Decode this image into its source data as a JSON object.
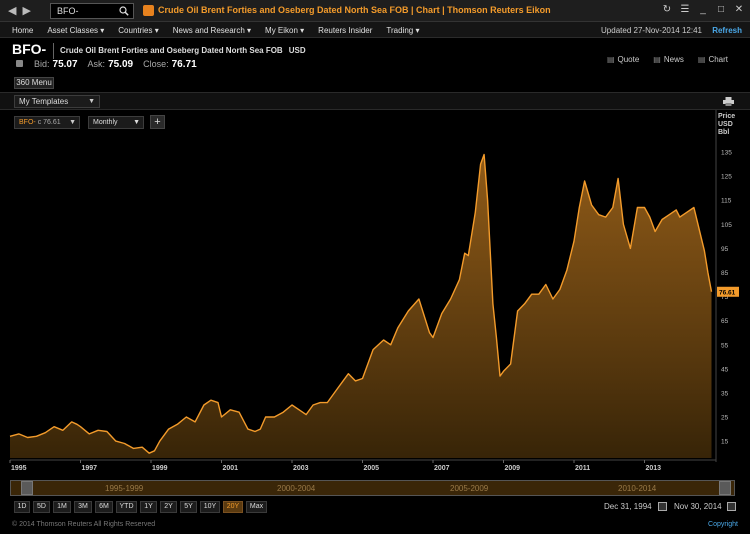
{
  "titlebar": {
    "search_value": "BFO-",
    "window_title": "Crude Oil Brent Forties and Oseberg Dated North Sea FOB | Chart | Thomson Reuters Eikon"
  },
  "menubar": {
    "items": [
      "Home",
      "Asset Classes ▾",
      "Countries ▾",
      "News and Research ▾",
      "My Eikon ▾",
      "Reuters Insider",
      "Trading ▾"
    ],
    "updated": "Updated 27-Nov-2014 12:41",
    "refresh": "Refresh"
  },
  "header": {
    "ric": "BFO-",
    "instrument_name": "Crude Oil Brent Forties and Oseberg Dated North Sea FOB",
    "currency": "USD",
    "bid_label": "Bid:",
    "bid": "75.07",
    "ask_label": "Ask:",
    "ask": "75.09",
    "close_label": "Close:",
    "close": "76.71",
    "links": [
      "Quote",
      "News",
      "Chart"
    ],
    "menu360": "360 Menu"
  },
  "templates": {
    "label": "My Templates"
  },
  "chart_toolbar": {
    "series_ric": "BFO-",
    "series_value": "c 76.61",
    "interval": "Monthly",
    "add": "+"
  },
  "chart_data": {
    "type": "area",
    "title": "",
    "ylabel": "Price USD Bbl",
    "ylim": [
      8,
      140
    ],
    "yticks": [
      15,
      25,
      35,
      45,
      55,
      65,
      75,
      85,
      95,
      105,
      115,
      125,
      135
    ],
    "xticks": [
      "1995",
      "1997",
      "1999",
      "2001",
      "2003",
      "2005",
      "2007",
      "2009",
      "2011",
      "2013"
    ],
    "xlim": [
      1995.0,
      2015.0
    ],
    "last_value_label": "76.61",
    "color": "#f39b2b",
    "grid": false,
    "series": [
      {
        "x": [
          1995.0,
          1995.25,
          1995.5,
          1995.75,
          1996.0,
          1996.25,
          1996.5,
          1996.75,
          1996.9,
          1997.0,
          1997.25,
          1997.5,
          1997.75,
          1998.0,
          1998.25,
          1998.5,
          1998.75,
          1998.95,
          1999.1,
          1999.25,
          1999.5,
          1999.75,
          2000.0,
          2000.25,
          2000.5,
          2000.7,
          2000.9,
          2001.0,
          2001.25,
          2001.5,
          2001.75,
          2001.95,
          2002.1,
          2002.25,
          2002.5,
          2002.75,
          2003.0,
          2003.2,
          2003.4,
          2003.6,
          2003.8,
          2004.0,
          2004.3,
          2004.6,
          2004.8,
          2005.0,
          2005.3,
          2005.6,
          2005.8,
          2006.0,
          2006.3,
          2006.6,
          2006.9,
          2007.0,
          2007.25,
          2007.5,
          2007.75,
          2007.9,
          2008.0,
          2008.2,
          2008.35,
          2008.45,
          2008.55,
          2008.7,
          2008.8,
          2008.9,
          2009.0,
          2009.2,
          2009.4,
          2009.6,
          2009.8,
          2010.0,
          2010.2,
          2010.4,
          2010.6,
          2010.8,
          2011.0,
          2011.15,
          2011.3,
          2011.5,
          2011.7,
          2011.9,
          2012.1,
          2012.25,
          2012.4,
          2012.6,
          2012.8,
          2013.0,
          2013.15,
          2013.3,
          2013.5,
          2013.7,
          2013.9,
          2014.0,
          2014.2,
          2014.4,
          2014.5,
          2014.6,
          2014.7,
          2014.8,
          2014.9
        ],
        "y": [
          17,
          18,
          16.5,
          17,
          18.5,
          21,
          19.5,
          23,
          22,
          21,
          18,
          19.5,
          19,
          15,
          14,
          12,
          12.5,
          10,
          11,
          15,
          20,
          22,
          25,
          23,
          30,
          32,
          31,
          25,
          28,
          27,
          20,
          19,
          20,
          25,
          25,
          27,
          30,
          28,
          26,
          30,
          31,
          31,
          37,
          43,
          40,
          41,
          53,
          57,
          55,
          62,
          69,
          74,
          60,
          58,
          68,
          74,
          82,
          93,
          92,
          110,
          130,
          134,
          115,
          72,
          58,
          42,
          44,
          47,
          69,
          72,
          76,
          76,
          80,
          74,
          78,
          86,
          98,
          112,
          123,
          113,
          109,
          108,
          112,
          124,
          105,
          95,
          112,
          112,
          108,
          102,
          107,
          109,
          111,
          108,
          110,
          112,
          106,
          100,
          94,
          85,
          77
        ]
      }
    ]
  },
  "navigator": {
    "labels": [
      "1995-1999",
      "2000-2004",
      "2005-2009",
      "2010-2014"
    ]
  },
  "rangebar": {
    "buttons": [
      "1D",
      "5D",
      "1M",
      "3M",
      "6M",
      "YTD",
      "1Y",
      "2Y",
      "5Y",
      "10Y",
      "20Y",
      "Max"
    ],
    "active": "20Y",
    "start_date": "Dec 31, 1994",
    "end_date": "Nov 30, 2014"
  },
  "footer": {
    "copyright": "© 2014 Thomson Reuters All Rights Reserved",
    "link": "Copyright"
  }
}
